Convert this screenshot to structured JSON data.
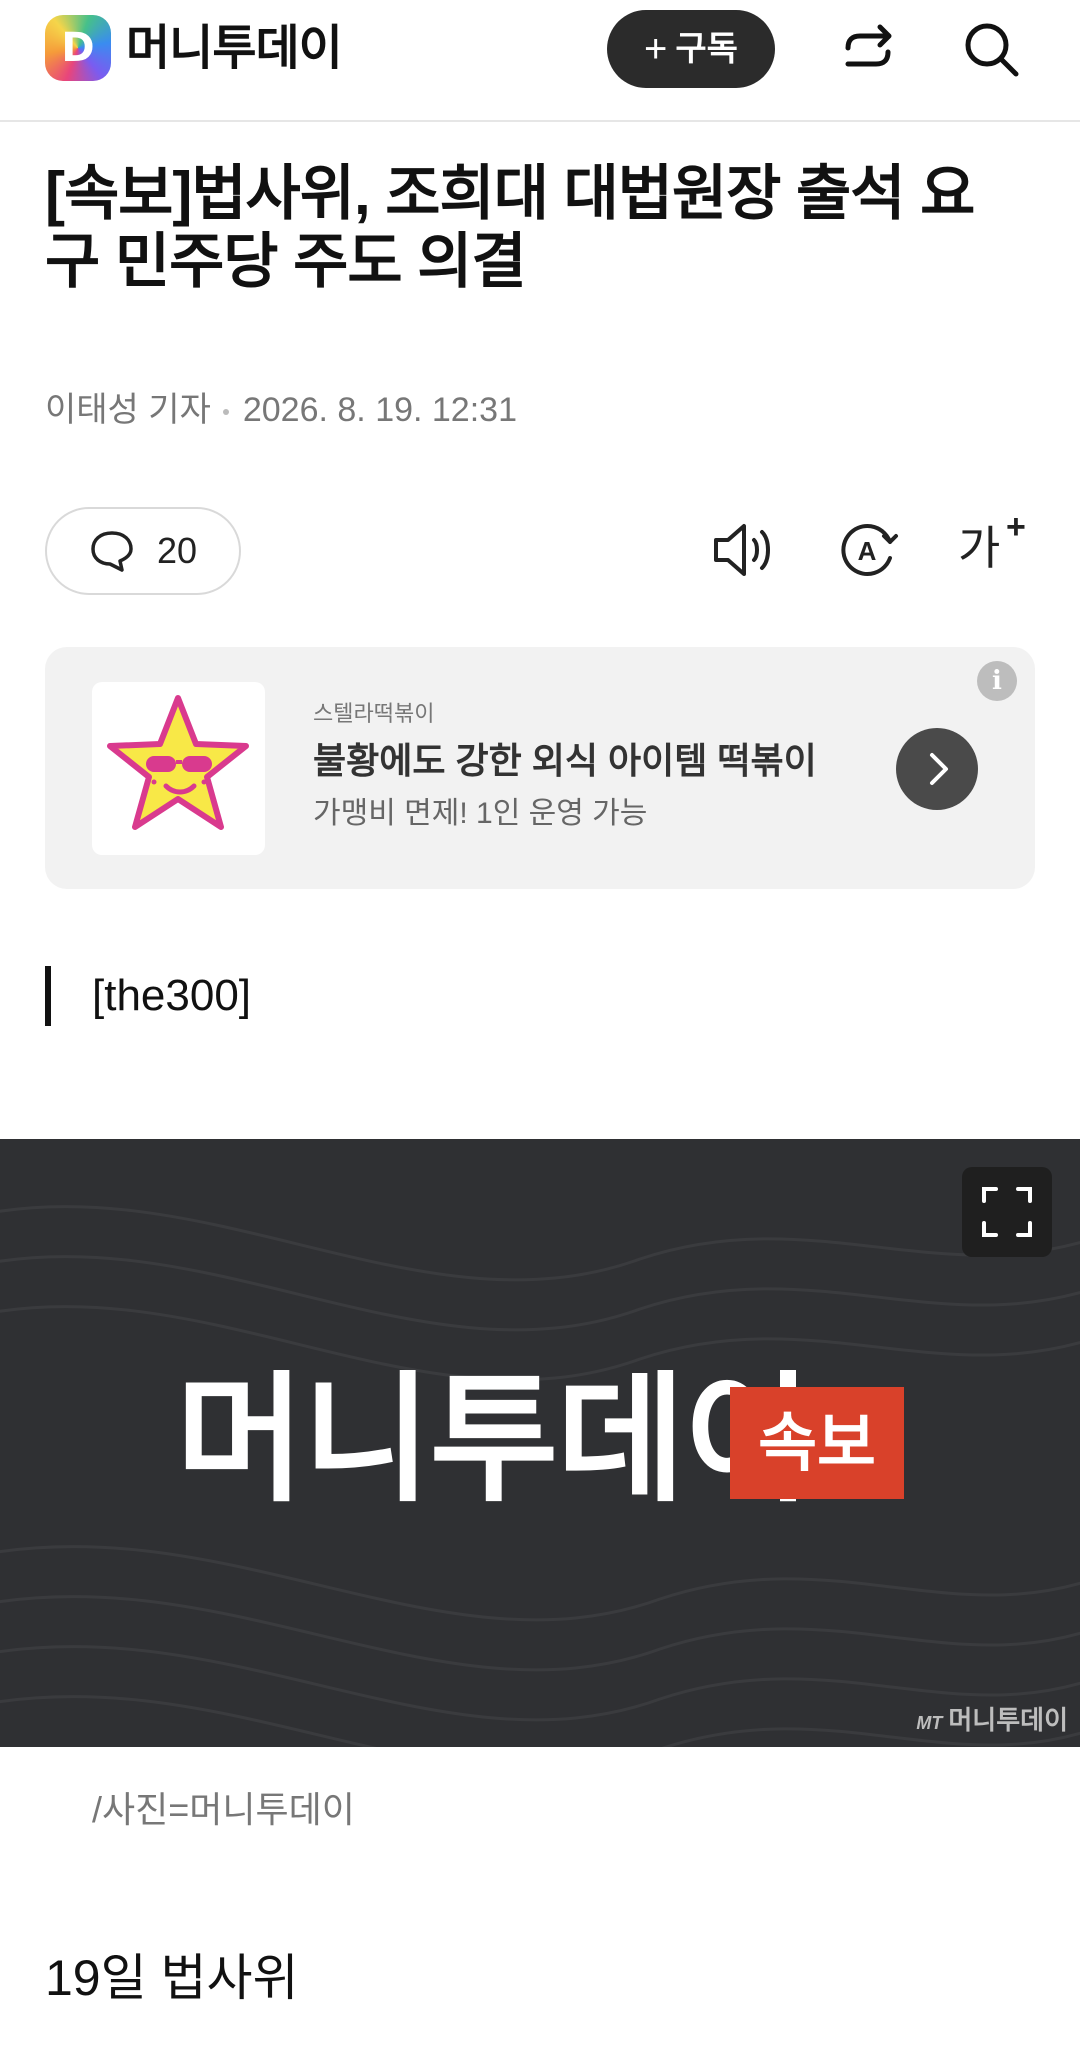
{
  "header": {
    "brand": "머니투데이",
    "logo_letter": "D",
    "subscribe_label": "구독",
    "subscribe_icon": "plus-icon",
    "share_icon": "share-icon",
    "search_icon": "search-icon"
  },
  "article": {
    "title": "[속보]법사위, 조희대 대법원장 출석 요구 민주당 주도 의결",
    "author": "이태성 기자",
    "date": "2026. 8. 19. 12:31",
    "comment_count": "20",
    "section_label": "[the300]",
    "photo": {
      "brand_text": "머니투데이",
      "tag": "속보",
      "watermark_prefix": "MT",
      "watermark": "머니투데이"
    },
    "caption": "/사진=머니투데이",
    "body_first_line": "19일 법사위"
  },
  "toolbar": {
    "comment_icon": "comment-icon",
    "speaker_icon": "speaker-icon",
    "translate_icon": "auto-translate-icon",
    "font_size_label": "가",
    "font_size_icon": "font-size-icon"
  },
  "ad": {
    "brand": "스텔라떡볶이",
    "headline": "불황에도 강한 외식 아이템 떡볶이",
    "subtitle": "가맹비 면제! 1인 운영 가능",
    "info_icon": "info-icon",
    "arrow_icon": "chevron-right-icon"
  },
  "colors": {
    "subscribe_bg": "#2b2b2b",
    "breaking_tag": "#d9412a",
    "photo_bg": "#2f3033",
    "ad_bg": "#f2f2f2"
  }
}
